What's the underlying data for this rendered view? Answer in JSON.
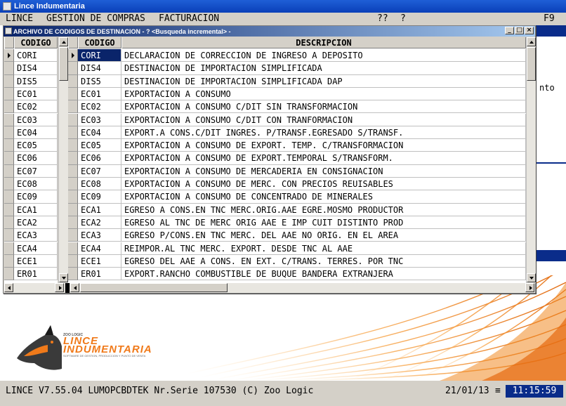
{
  "app": {
    "window_title": "Lince Indumentaria"
  },
  "menubar": {
    "items": [
      "LINCE",
      "GESTION DE COMPRAS",
      "FACTURACION"
    ],
    "help1": "??",
    "help2": "?",
    "f9": "F9"
  },
  "background_window": {
    "fragment_text": "nto"
  },
  "dialog": {
    "title": "ARCHIVO DE CODIGOS DE DESTINACION - ? <Busqueda incremental> -",
    "left_grid": {
      "header": "CODIGO",
      "codes": [
        "CORI",
        "DIS4",
        "DIS5",
        "EC01",
        "EC02",
        "EC03",
        "EC04",
        "EC05",
        "EC06",
        "EC07",
        "EC08",
        "EC09",
        "ECA1",
        "ECA2",
        "ECA3",
        "ECA4",
        "ECE1",
        "ER01"
      ]
    },
    "right_grid": {
      "headers": [
        "CODIGO",
        "DESCRIPCION"
      ],
      "rows": [
        {
          "code": "CORI",
          "desc": "DECLARACION DE CORRECCION DE INGRESO A DEPOSITO"
        },
        {
          "code": "DIS4",
          "desc": "DESTINACION DE IMPORTACION SIMPLIFICADA"
        },
        {
          "code": "DIS5",
          "desc": "DESTINACION DE IMPORTACION SIMPLIFICADA DAP"
        },
        {
          "code": "EC01",
          "desc": "EXPORTACION A CONSUMO"
        },
        {
          "code": "EC02",
          "desc": "EXPORTACION A CONSUMO C/DIT SIN TRANSFORMACION"
        },
        {
          "code": "EC03",
          "desc": "EXPORTACION A CONSUMO C/DIT CON TRANFORMACION"
        },
        {
          "code": "EC04",
          "desc": "EXPORT.A CONS.C/DIT INGRES. P/TRANSF.EGRESADO S/TRANSF."
        },
        {
          "code": "EC05",
          "desc": "EXPORTACION A CONSUMO DE EXPORT. TEMP. C/TRANSFORMACION"
        },
        {
          "code": "EC06",
          "desc": "EXPORTACION A CONSUMO DE EXPORT.TEMPORAL S/TRANSFORM."
        },
        {
          "code": "EC07",
          "desc": "EXPORTACION A CONSUMO DE MERCADERIA EN CONSIGNACION"
        },
        {
          "code": "EC08",
          "desc": "EXPORTACION A CONSUMO DE MERC. CON PRECIOS REUISABLES"
        },
        {
          "code": "EC09",
          "desc": "EXPORTACION A CONSUMO DE CONCENTRADO DE MINERALES"
        },
        {
          "code": "ECA1",
          "desc": "EGRESO A CONS.EN TNC MERC.ORIG.AAE EGRE.MOSMO PRODUCTOR"
        },
        {
          "code": "ECA2",
          "desc": "EGRESO AL TNC DE MERC ORIG AAE E IMP CUIT DISTINTO PROD"
        },
        {
          "code": "ECA3",
          "desc": "EGRESO P/CONS.EN TNC MERC. DEL AAE NO ORIG. EN EL AREA"
        },
        {
          "code": "ECA4",
          "desc": "REIMPOR.AL TNC MERC. EXPORT. DESDE TNC AL AAE"
        },
        {
          "code": "ECE1",
          "desc": "EGRESO DEL AAE A CONS. EN EXT. C/TRANS. TERRES. POR TNC"
        },
        {
          "code": "ER01",
          "desc": "EXPORT.RANCHO COMBUSTIBLE DE BUQUE BANDERA EXTRANJERA"
        }
      ],
      "selected_row": 0
    }
  },
  "logo": {
    "small": "ZOO LOGIC",
    "line1": "LINCE",
    "line2": "INDUMENTARIA",
    "tagline": "SOFTWARE DE GESTION, PRODUCCION Y PUNTO DE VENTA"
  },
  "statusbar": {
    "text": "LINCE  V7.55.04 LUMOPCBDTEK Nr.Serie 107530 (C) Zoo Logic",
    "date": "21/01/13",
    "sep": "≡",
    "time": "11:15:59"
  },
  "colors": {
    "title_blue": "#0a246a",
    "accent_orange": "#f07a1a",
    "selection": "#0a246a"
  }
}
